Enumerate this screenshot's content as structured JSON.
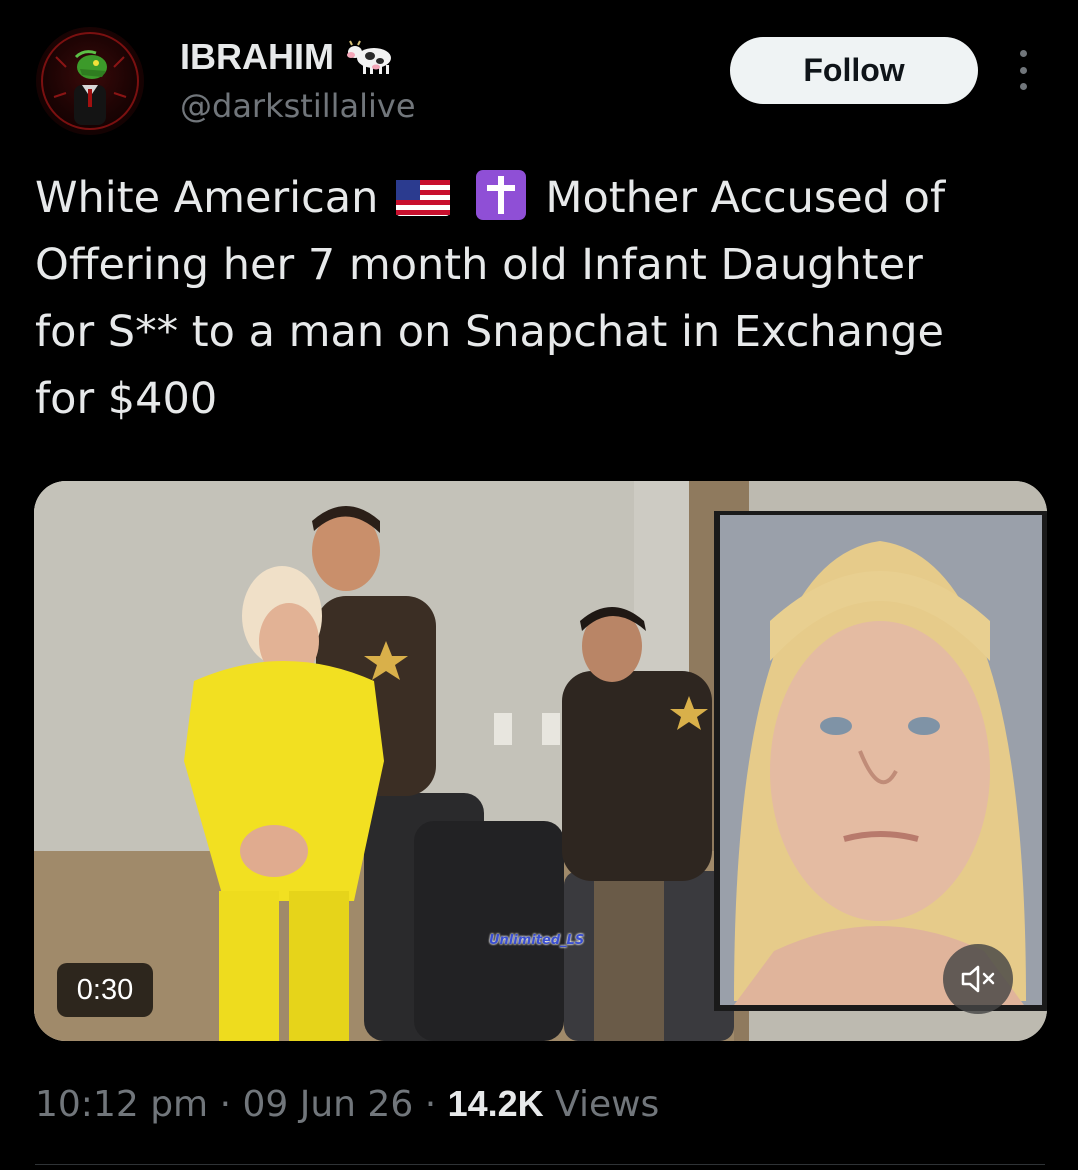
{
  "author": {
    "display_name": "IBRAHIM",
    "badge_icon": "cow-emoji-icon",
    "handle": "@darkstillalive",
    "avatar_icon": "lizard-avatar-icon"
  },
  "follow_label": "Follow",
  "more_icon": "more-options-icon",
  "tweet": {
    "line1_a": "White American",
    "line1_b": "Mother Accused of",
    "line2": "Offering her 7 month old Infant Daughter",
    "line3": "for S** to a man on Snapchat in Exchange",
    "line4": "for $400",
    "emoji_1": "us-flag-icon",
    "emoji_2": "latin-cross-icon"
  },
  "media": {
    "duration": "0:30",
    "watermark": "Unlimited_LS",
    "mute_icon": "speaker-muted-icon"
  },
  "meta": {
    "time": "10:12 pm",
    "sep1": "·",
    "date": "09 Jun 26",
    "sep2": "·",
    "views_count": "14.2K",
    "views_label": "Views"
  },
  "colors": {
    "background": "#000000",
    "text_primary": "#e7e9ea",
    "text_secondary": "#71767b",
    "follow_bg": "#eff3f4"
  }
}
